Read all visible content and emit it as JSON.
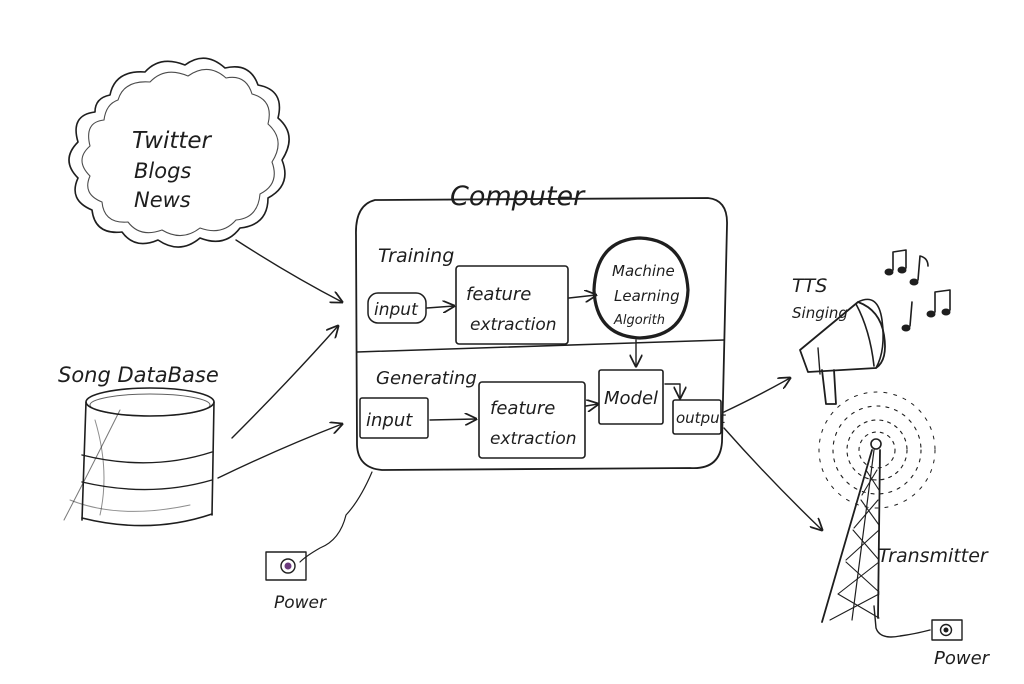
{
  "sources": {
    "cloud_lines": [
      "Twitter",
      "Blogs",
      "News"
    ],
    "song_database": "Song DataBase"
  },
  "computer": {
    "title": "Computer",
    "training": {
      "label": "Training",
      "input": "input",
      "feature_lines": [
        "feature",
        "extraction"
      ],
      "ml_lines": [
        "Machine",
        "Learning",
        "Algorith"
      ]
    },
    "generating": {
      "label": "Generating",
      "input": "input",
      "feature_lines": [
        "feature",
        "extraction"
      ],
      "model": "Model",
      "output": "output"
    }
  },
  "outputs": {
    "tts_lines": [
      "TTS",
      "Singing"
    ],
    "transmitter": "Transmitter"
  },
  "power": {
    "left": "Power",
    "right": "Power"
  },
  "colors": {
    "ink": "#1e1e1e",
    "plug_accent": "#6b3a7d"
  },
  "icons": [
    "cloud",
    "database-cylinder",
    "megaphone",
    "music-notes",
    "radio-tower",
    "power-socket"
  ]
}
